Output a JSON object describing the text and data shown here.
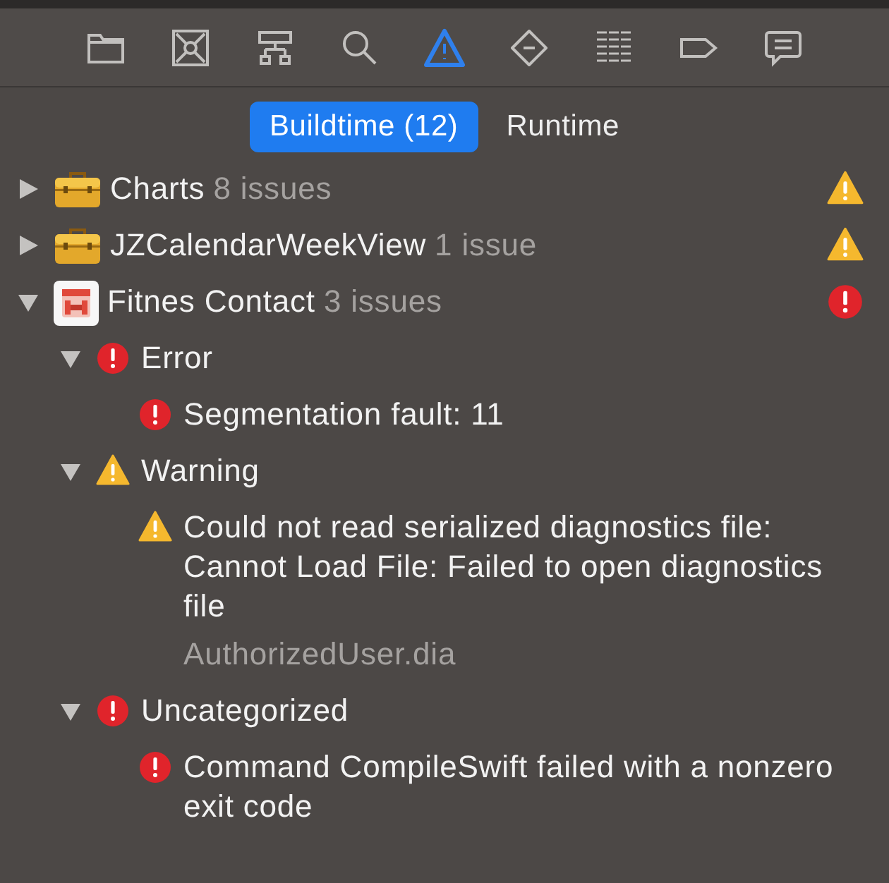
{
  "navigator_tabs": [
    {
      "kind": "folder",
      "selected": false
    },
    {
      "kind": "target",
      "selected": false
    },
    {
      "kind": "hierarchy",
      "selected": false
    },
    {
      "kind": "search",
      "selected": false
    },
    {
      "kind": "warning",
      "selected": true
    },
    {
      "kind": "diamond",
      "selected": false
    },
    {
      "kind": "list",
      "selected": false
    },
    {
      "kind": "tag",
      "selected": false
    },
    {
      "kind": "bubble",
      "selected": false
    }
  ],
  "scope_tabs": [
    {
      "label": "Buildtime (12)",
      "selected": true
    },
    {
      "label": "Runtime",
      "selected": false
    }
  ],
  "projects": [
    {
      "kind": "framework",
      "title": "Charts",
      "count": "8 issues",
      "badge": {
        "kind": "warning"
      },
      "expanded": false
    },
    {
      "kind": "framework",
      "title": "JZCalendarWeekView",
      "count": "1 issue",
      "badge": {
        "kind": "warning"
      },
      "expanded": false
    },
    {
      "kind": "app",
      "title": "Fitnes Contact",
      "count": "3 issues",
      "badge": {
        "kind": "error"
      },
      "expanded": true,
      "categories": [
        {
          "kind": "error",
          "title": "Error",
          "expanded": true,
          "issues": [
            {
              "kind": "error",
              "title": "Segmentation fault: 11"
            }
          ]
        },
        {
          "kind": "warning",
          "title": "Warning",
          "expanded": true,
          "issues": [
            {
              "kind": "warning",
              "title": "Could not read serialized diagnostics file: Cannot Load File: Failed to open diagnostics file",
              "detail": "AuthorizedUser.dia"
            }
          ]
        },
        {
          "kind": "error",
          "title": "Uncategorized",
          "expanded": true,
          "issues": [
            {
              "kind": "error",
              "title": "Command CompileSwift failed with a nonzero exit code"
            }
          ]
        }
      ]
    }
  ]
}
